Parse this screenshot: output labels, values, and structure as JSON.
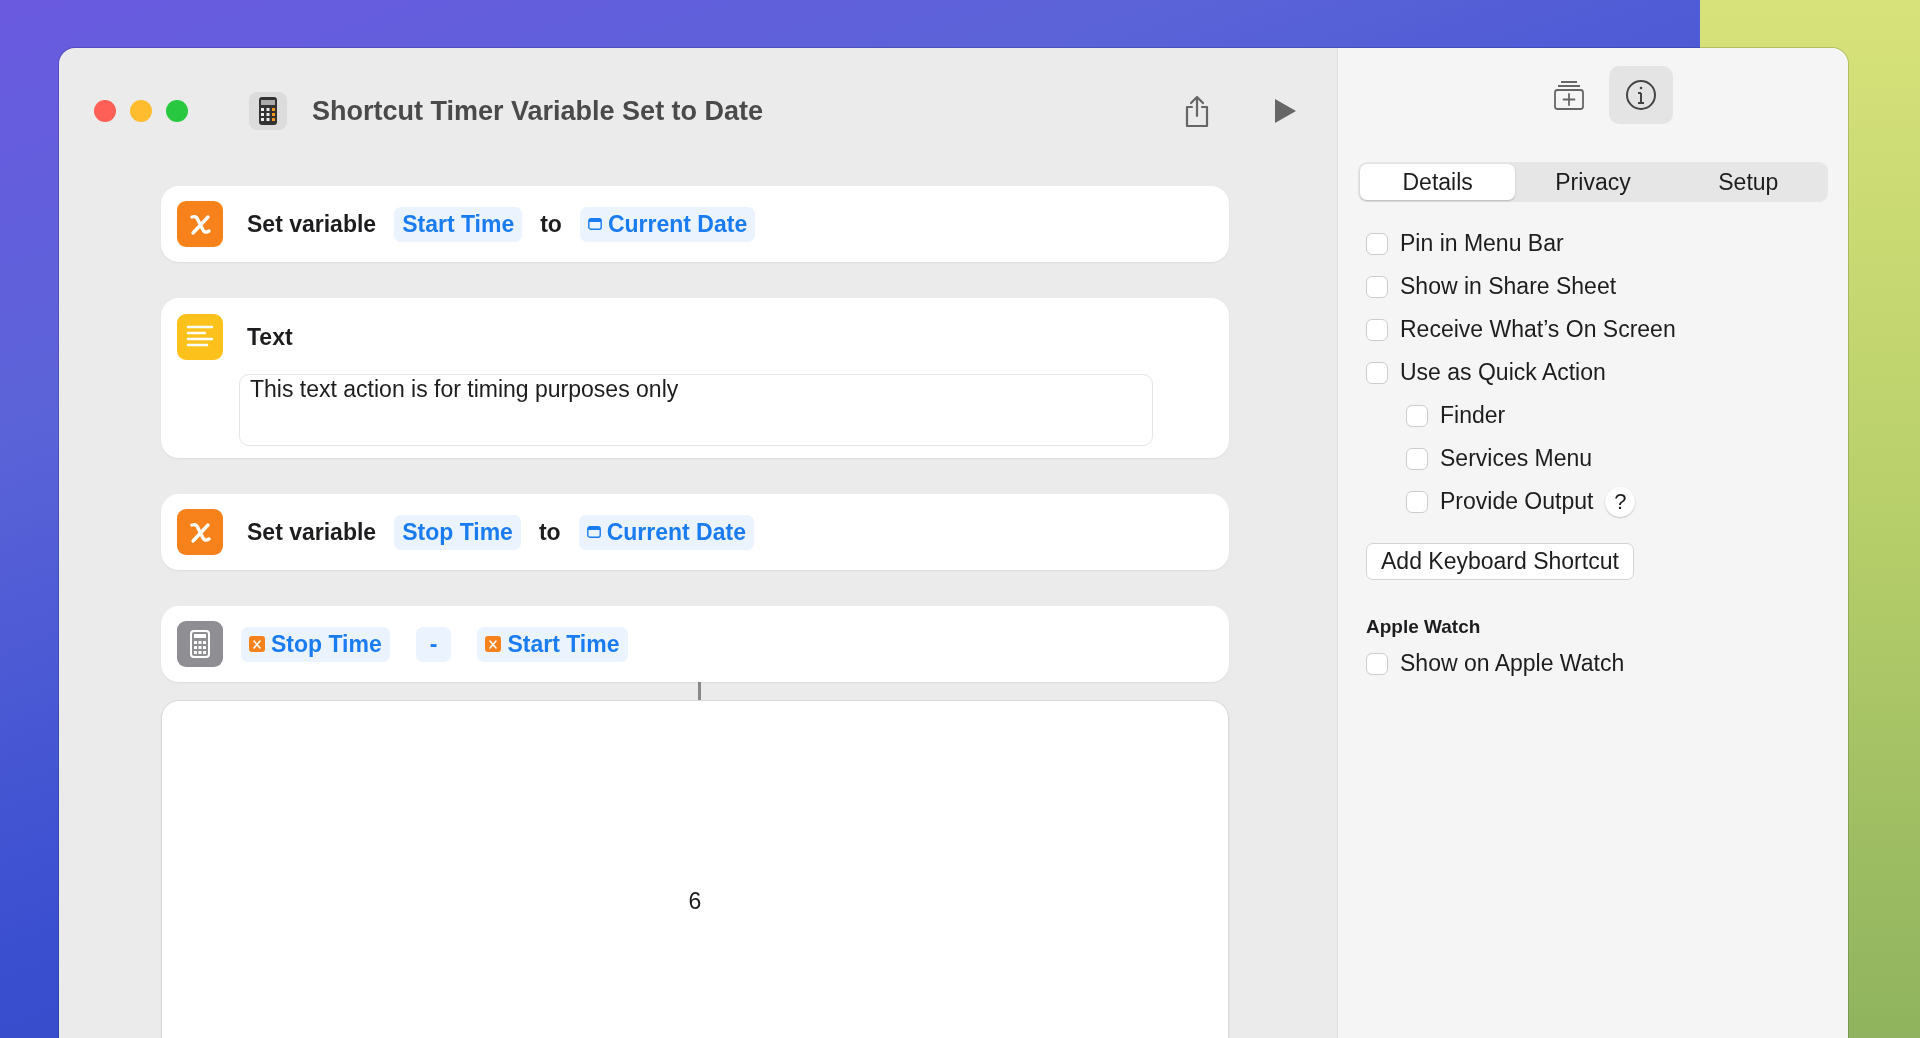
{
  "window": {
    "title": "Shortcut Timer Variable Set to Date"
  },
  "actions": [
    {
      "kind": "set_variable",
      "label": "Set variable",
      "variable": "Start Time",
      "connector": "to",
      "value": "Current Date"
    },
    {
      "kind": "text",
      "title": "Text",
      "body": "This text action is for timing purposes only"
    },
    {
      "kind": "set_variable",
      "label": "Set variable",
      "variable": "Stop Time",
      "connector": "to",
      "value": "Current Date"
    },
    {
      "kind": "calculate",
      "operand_1": "Stop Time",
      "operator": "-",
      "operand_2": "Start Time"
    }
  ],
  "result": {
    "value": "6"
  },
  "sidebar": {
    "tabs": [
      {
        "label": "Details",
        "selected": true
      },
      {
        "label": "Privacy",
        "selected": false
      },
      {
        "label": "Setup",
        "selected": false
      }
    ],
    "options": [
      {
        "label": "Pin in Menu Bar",
        "checked": false
      },
      {
        "label": "Show in Share Sheet",
        "checked": false
      },
      {
        "label": "Receive What’s On Screen",
        "checked": false
      },
      {
        "label": "Use as Quick Action",
        "checked": false,
        "children": [
          {
            "label": "Finder",
            "checked": false
          },
          {
            "label": "Services Menu",
            "checked": false
          },
          {
            "label": "Provide Output",
            "checked": false,
            "help": "?"
          }
        ]
      }
    ],
    "button": "Add Keyboard Shortcut",
    "section": {
      "title": "Apple Watch",
      "options": [
        {
          "label": "Show on Apple Watch",
          "checked": false
        }
      ]
    }
  }
}
